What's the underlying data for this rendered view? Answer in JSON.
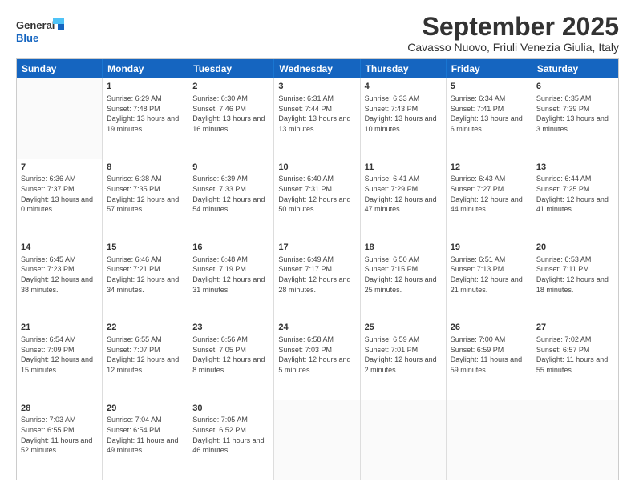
{
  "logo": {
    "general": "General",
    "blue": "Blue"
  },
  "title": "September 2025",
  "location": "Cavasso Nuovo, Friuli Venezia Giulia, Italy",
  "days": [
    "Sunday",
    "Monday",
    "Tuesday",
    "Wednesday",
    "Thursday",
    "Friday",
    "Saturday"
  ],
  "weeks": [
    [
      {
        "day": "",
        "empty": true
      },
      {
        "day": "1",
        "sunrise": "Sunrise: 6:29 AM",
        "sunset": "Sunset: 7:48 PM",
        "daylight": "Daylight: 13 hours and 19 minutes."
      },
      {
        "day": "2",
        "sunrise": "Sunrise: 6:30 AM",
        "sunset": "Sunset: 7:46 PM",
        "daylight": "Daylight: 13 hours and 16 minutes."
      },
      {
        "day": "3",
        "sunrise": "Sunrise: 6:31 AM",
        "sunset": "Sunset: 7:44 PM",
        "daylight": "Daylight: 13 hours and 13 minutes."
      },
      {
        "day": "4",
        "sunrise": "Sunrise: 6:33 AM",
        "sunset": "Sunset: 7:43 PM",
        "daylight": "Daylight: 13 hours and 10 minutes."
      },
      {
        "day": "5",
        "sunrise": "Sunrise: 6:34 AM",
        "sunset": "Sunset: 7:41 PM",
        "daylight": "Daylight: 13 hours and 6 minutes."
      },
      {
        "day": "6",
        "sunrise": "Sunrise: 6:35 AM",
        "sunset": "Sunset: 7:39 PM",
        "daylight": "Daylight: 13 hours and 3 minutes."
      }
    ],
    [
      {
        "day": "7",
        "sunrise": "Sunrise: 6:36 AM",
        "sunset": "Sunset: 7:37 PM",
        "daylight": "Daylight: 13 hours and 0 minutes."
      },
      {
        "day": "8",
        "sunrise": "Sunrise: 6:38 AM",
        "sunset": "Sunset: 7:35 PM",
        "daylight": "Daylight: 12 hours and 57 minutes."
      },
      {
        "day": "9",
        "sunrise": "Sunrise: 6:39 AM",
        "sunset": "Sunset: 7:33 PM",
        "daylight": "Daylight: 12 hours and 54 minutes."
      },
      {
        "day": "10",
        "sunrise": "Sunrise: 6:40 AM",
        "sunset": "Sunset: 7:31 PM",
        "daylight": "Daylight: 12 hours and 50 minutes."
      },
      {
        "day": "11",
        "sunrise": "Sunrise: 6:41 AM",
        "sunset": "Sunset: 7:29 PM",
        "daylight": "Daylight: 12 hours and 47 minutes."
      },
      {
        "day": "12",
        "sunrise": "Sunrise: 6:43 AM",
        "sunset": "Sunset: 7:27 PM",
        "daylight": "Daylight: 12 hours and 44 minutes."
      },
      {
        "day": "13",
        "sunrise": "Sunrise: 6:44 AM",
        "sunset": "Sunset: 7:25 PM",
        "daylight": "Daylight: 12 hours and 41 minutes."
      }
    ],
    [
      {
        "day": "14",
        "sunrise": "Sunrise: 6:45 AM",
        "sunset": "Sunset: 7:23 PM",
        "daylight": "Daylight: 12 hours and 38 minutes."
      },
      {
        "day": "15",
        "sunrise": "Sunrise: 6:46 AM",
        "sunset": "Sunset: 7:21 PM",
        "daylight": "Daylight: 12 hours and 34 minutes."
      },
      {
        "day": "16",
        "sunrise": "Sunrise: 6:48 AM",
        "sunset": "Sunset: 7:19 PM",
        "daylight": "Daylight: 12 hours and 31 minutes."
      },
      {
        "day": "17",
        "sunrise": "Sunrise: 6:49 AM",
        "sunset": "Sunset: 7:17 PM",
        "daylight": "Daylight: 12 hours and 28 minutes."
      },
      {
        "day": "18",
        "sunrise": "Sunrise: 6:50 AM",
        "sunset": "Sunset: 7:15 PM",
        "daylight": "Daylight: 12 hours and 25 minutes."
      },
      {
        "day": "19",
        "sunrise": "Sunrise: 6:51 AM",
        "sunset": "Sunset: 7:13 PM",
        "daylight": "Daylight: 12 hours and 21 minutes."
      },
      {
        "day": "20",
        "sunrise": "Sunrise: 6:53 AM",
        "sunset": "Sunset: 7:11 PM",
        "daylight": "Daylight: 12 hours and 18 minutes."
      }
    ],
    [
      {
        "day": "21",
        "sunrise": "Sunrise: 6:54 AM",
        "sunset": "Sunset: 7:09 PM",
        "daylight": "Daylight: 12 hours and 15 minutes."
      },
      {
        "day": "22",
        "sunrise": "Sunrise: 6:55 AM",
        "sunset": "Sunset: 7:07 PM",
        "daylight": "Daylight: 12 hours and 12 minutes."
      },
      {
        "day": "23",
        "sunrise": "Sunrise: 6:56 AM",
        "sunset": "Sunset: 7:05 PM",
        "daylight": "Daylight: 12 hours and 8 minutes."
      },
      {
        "day": "24",
        "sunrise": "Sunrise: 6:58 AM",
        "sunset": "Sunset: 7:03 PM",
        "daylight": "Daylight: 12 hours and 5 minutes."
      },
      {
        "day": "25",
        "sunrise": "Sunrise: 6:59 AM",
        "sunset": "Sunset: 7:01 PM",
        "daylight": "Daylight: 12 hours and 2 minutes."
      },
      {
        "day": "26",
        "sunrise": "Sunrise: 7:00 AM",
        "sunset": "Sunset: 6:59 PM",
        "daylight": "Daylight: 11 hours and 59 minutes."
      },
      {
        "day": "27",
        "sunrise": "Sunrise: 7:02 AM",
        "sunset": "Sunset: 6:57 PM",
        "daylight": "Daylight: 11 hours and 55 minutes."
      }
    ],
    [
      {
        "day": "28",
        "sunrise": "Sunrise: 7:03 AM",
        "sunset": "Sunset: 6:55 PM",
        "daylight": "Daylight: 11 hours and 52 minutes."
      },
      {
        "day": "29",
        "sunrise": "Sunrise: 7:04 AM",
        "sunset": "Sunset: 6:54 PM",
        "daylight": "Daylight: 11 hours and 49 minutes."
      },
      {
        "day": "30",
        "sunrise": "Sunrise: 7:05 AM",
        "sunset": "Sunset: 6:52 PM",
        "daylight": "Daylight: 11 hours and 46 minutes."
      },
      {
        "day": "",
        "empty": true
      },
      {
        "day": "",
        "empty": true
      },
      {
        "day": "",
        "empty": true
      },
      {
        "day": "",
        "empty": true
      }
    ]
  ]
}
